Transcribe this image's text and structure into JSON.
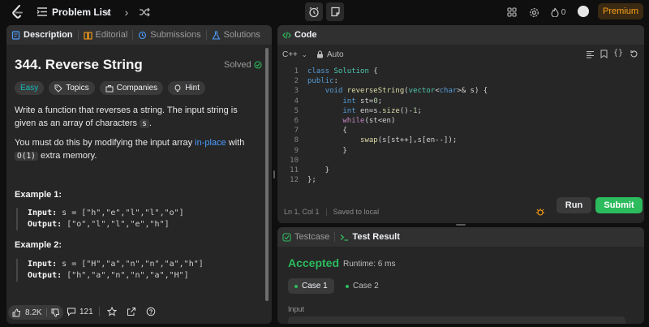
{
  "nav": {
    "title": "Problem List",
    "premium_label": "Premium",
    "streak_count": "0",
    "icons": [
      "leetcode-logo",
      "list-icon",
      "chevron-left-icon",
      "chevron-right-icon",
      "shuffle-icon",
      "alarm-icon",
      "note-icon",
      "grid-icon",
      "gear-icon",
      "flame-icon"
    ]
  },
  "left_panel": {
    "tabs": [
      {
        "label": "Description",
        "icon": "description-icon"
      },
      {
        "label": "Editorial",
        "icon": "book-icon"
      },
      {
        "label": "Submissions",
        "icon": "history-icon"
      },
      {
        "label": "Solutions",
        "icon": "flask-icon"
      }
    ],
    "problem_title": "344. Reverse String",
    "solved_label": "Solved",
    "tags": [
      {
        "label": "Easy"
      },
      {
        "label": "Topics"
      },
      {
        "label": "Companies"
      },
      {
        "label": "Hint"
      }
    ],
    "desc_1a": "Write a function that reverses a string. The input string is given as an array of characters ",
    "desc_1_code": "s",
    "desc_1b": ".",
    "desc_2a": "You must do this by modifying the input array ",
    "desc_2_link": "in-place",
    "desc_2b": " with ",
    "desc_2_code": "O(1)",
    "desc_2c": " extra memory.",
    "examples": [
      {
        "title": "Example 1:",
        "input_label": "Input:",
        "input_value": "s = [\"h\",\"e\",\"l\",\"l\",\"o\"]",
        "output_label": "Output:",
        "output_value": "[\"o\",\"l\",\"l\",\"e\",\"h\"]"
      },
      {
        "title": "Example 2:",
        "input_label": "Input:",
        "input_value": "s = [\"H\",\"a\",\"n\",\"n\",\"a\",\"h\"]",
        "output_label": "Output:",
        "output_value": "[\"h\",\"a\",\"n\",\"n\",\"a\",\"H\"]"
      }
    ],
    "footer": {
      "likes": "8.2K",
      "comments": "121"
    }
  },
  "code_panel": {
    "tab_label": "Code",
    "language": "C++",
    "mode": "Auto",
    "status_position": "Ln 1, Col 1",
    "status_saved": "Saved to local",
    "run_label": "Run",
    "submit_label": "Submit"
  },
  "result_panel": {
    "tabs": [
      {
        "label": "Testcase"
      },
      {
        "label": "Test Result"
      }
    ],
    "verdict": "Accepted",
    "runtime": "Runtime: 6 ms",
    "cases": [
      "Case 1",
      "Case 2"
    ],
    "input_label": "Input"
  },
  "colors": {
    "accent_green": "#2cbb5d",
    "easy_teal": "#1cb8b8",
    "premium_orange": "#ffa116",
    "link_blue": "#4b9dff"
  }
}
